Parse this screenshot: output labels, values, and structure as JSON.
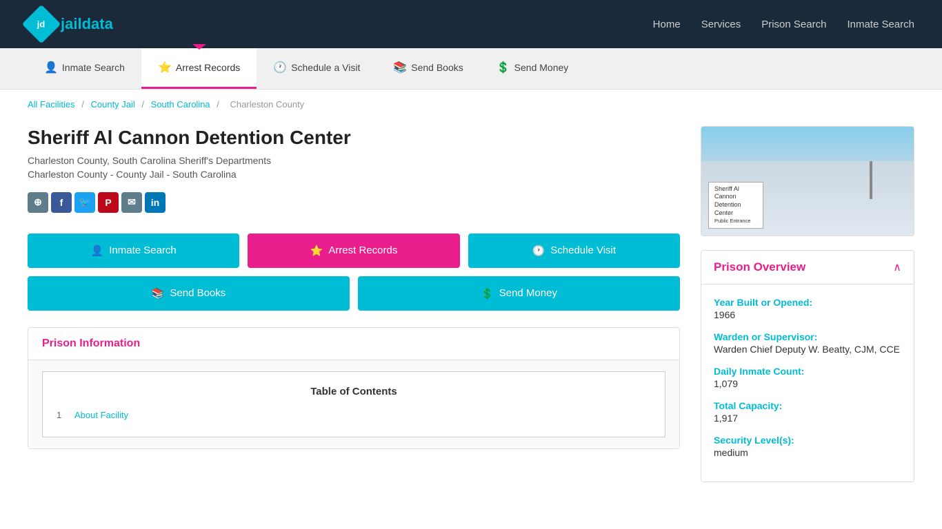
{
  "topNav": {
    "logoText": "jaildata",
    "logoInitials": "jd",
    "links": [
      {
        "label": "Home",
        "name": "home-link"
      },
      {
        "label": "Services",
        "name": "services-link"
      },
      {
        "label": "Prison Search",
        "name": "prison-search-link"
      },
      {
        "label": "Inmate Search",
        "name": "inmate-search-link"
      }
    ]
  },
  "secNav": {
    "items": [
      {
        "label": "Inmate Search",
        "icon": "👤",
        "active": false,
        "name": "sec-nav-inmate-search"
      },
      {
        "label": "Arrest Records",
        "icon": "⭐",
        "active": true,
        "name": "sec-nav-arrest-records"
      },
      {
        "label": "Schedule a Visit",
        "icon": "🕐",
        "active": false,
        "name": "sec-nav-schedule-visit"
      },
      {
        "label": "Send Books",
        "icon": "📚",
        "active": false,
        "name": "sec-nav-send-books"
      },
      {
        "label": "Send Money",
        "icon": "💲",
        "active": false,
        "name": "sec-nav-send-money"
      }
    ]
  },
  "breadcrumb": {
    "items": [
      {
        "label": "All Facilities",
        "href": "#",
        "name": "breadcrumb-all-facilities"
      },
      {
        "label": "County Jail",
        "href": "#",
        "name": "breadcrumb-county-jail"
      },
      {
        "label": "South Carolina",
        "href": "#",
        "name": "breadcrumb-south-carolina"
      },
      {
        "label": "Charleston County",
        "href": null,
        "name": "breadcrumb-charleston-county"
      }
    ]
  },
  "facility": {
    "title": "Sheriff Al Cannon Detention Center",
    "subtitle1": "Charleston County, South Carolina Sheriff's Departments",
    "subtitle2": "Charleston County - County Jail - South Carolina",
    "imageSign": "Sheriff Al Cannon\nDetention Center"
  },
  "socialIcons": [
    {
      "label": "⬡",
      "type": "share",
      "name": "share-icon"
    },
    {
      "label": "f",
      "type": "facebook",
      "name": "facebook-icon"
    },
    {
      "label": "🐦",
      "type": "twitter",
      "name": "twitter-icon"
    },
    {
      "label": "P",
      "type": "pinterest",
      "name": "pinterest-icon"
    },
    {
      "label": "✉",
      "type": "email",
      "name": "email-icon"
    },
    {
      "label": "in",
      "type": "linkedin",
      "name": "linkedin-icon"
    }
  ],
  "actionButtons": {
    "row1": [
      {
        "label": "Inmate Search",
        "icon": "👤",
        "style": "teal",
        "name": "inmate-search-button"
      },
      {
        "label": "Arrest Records",
        "icon": "⭐",
        "style": "pink",
        "name": "arrest-records-button"
      },
      {
        "label": "Schedule Visit",
        "icon": "🕐",
        "style": "teal",
        "name": "schedule-visit-button"
      }
    ],
    "row2": [
      {
        "label": "Send Books",
        "icon": "📚",
        "style": "teal",
        "name": "send-books-button"
      },
      {
        "label": "Send Money",
        "icon": "💲",
        "style": "teal",
        "name": "send-money-button"
      }
    ]
  },
  "prisonInfo": {
    "headerLabel": "Prison Information",
    "toc": {
      "title": "Table of Contents",
      "items": [
        {
          "num": "1",
          "label": "About Facility",
          "name": "toc-about-facility"
        }
      ]
    }
  },
  "prisonOverview": {
    "title": "Prison Overview",
    "fields": [
      {
        "label": "Year Built or Opened:",
        "value": "1966",
        "name": "overview-year-built"
      },
      {
        "label": "Warden or Supervisor:",
        "value": "Warden Chief Deputy W. Beatty, CJM, CCE",
        "name": "overview-warden"
      },
      {
        "label": "Daily Inmate Count:",
        "value": "1,079",
        "name": "overview-inmate-count"
      },
      {
        "label": "Total Capacity:",
        "value": "1,917",
        "name": "overview-total-capacity"
      },
      {
        "label": "Security Level(s):",
        "value": "medium",
        "name": "overview-security-level"
      }
    ]
  }
}
